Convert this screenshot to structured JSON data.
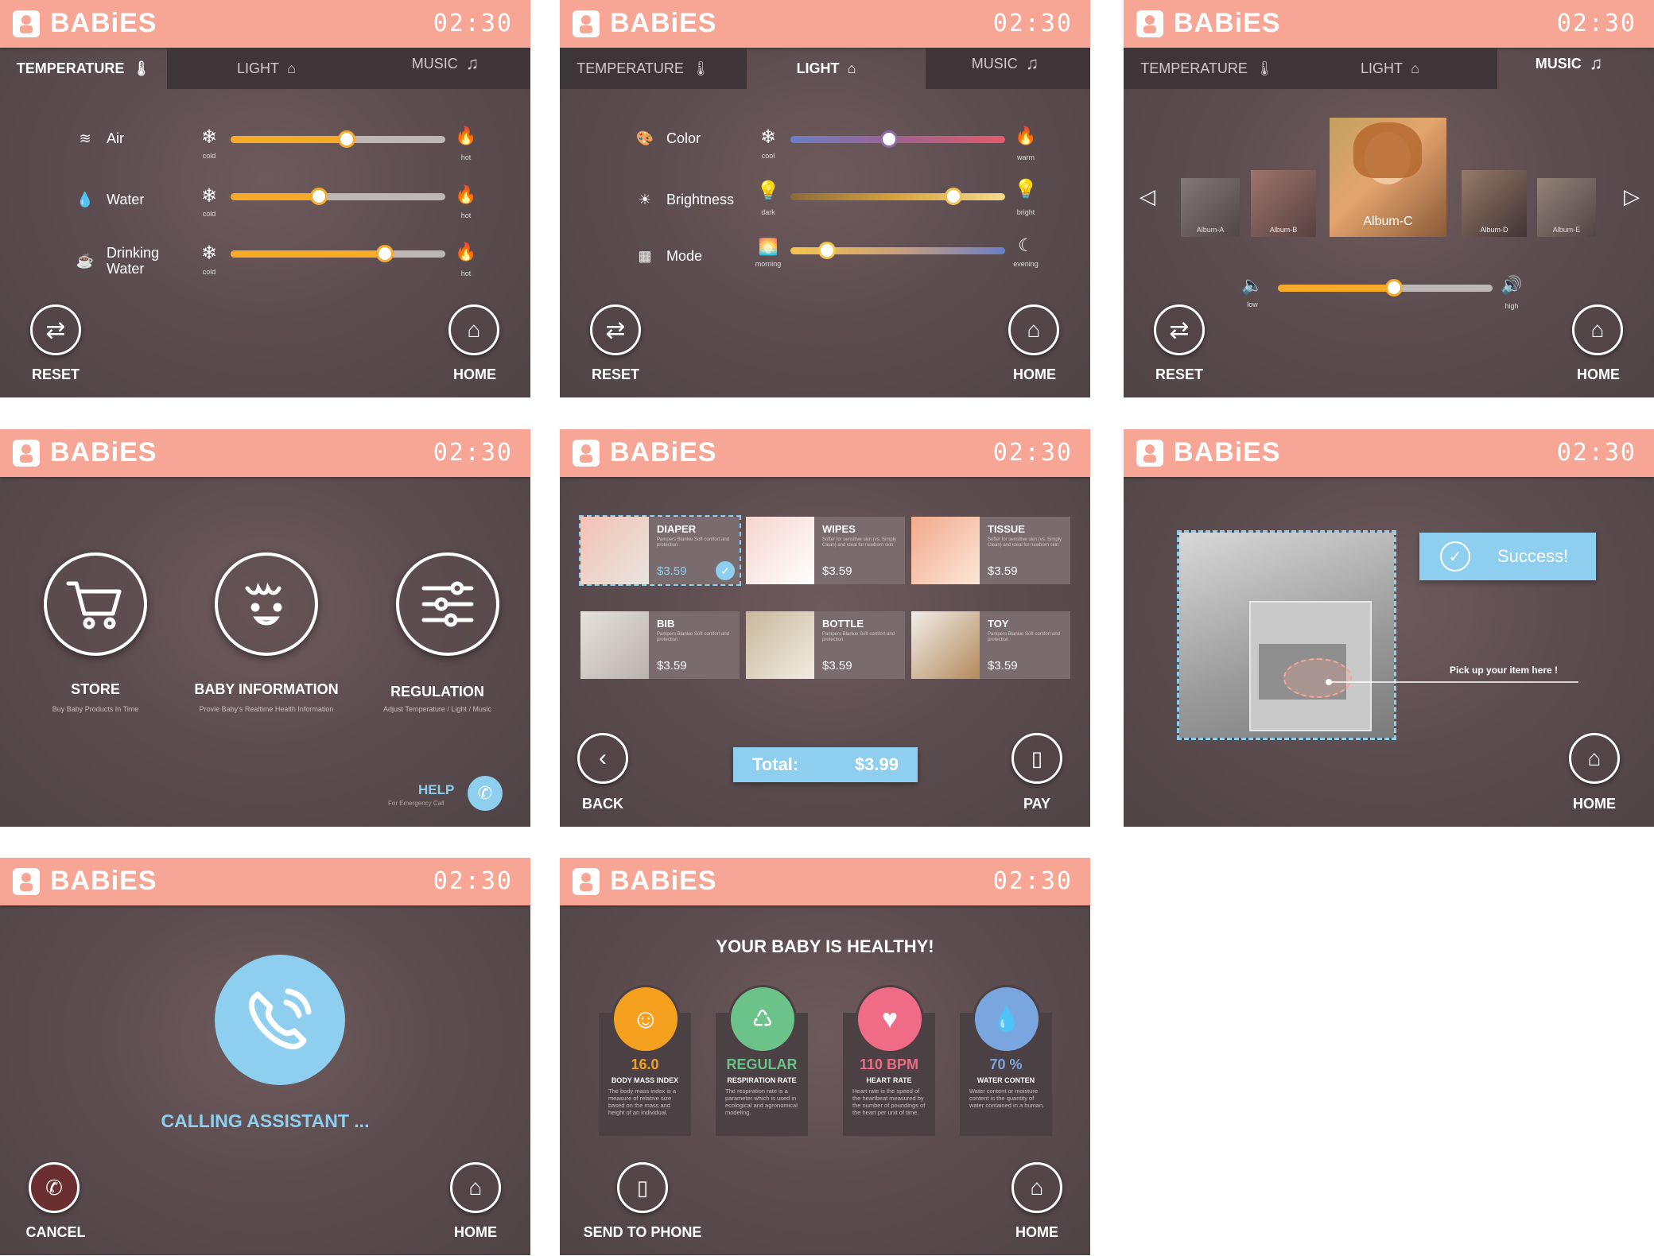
{
  "brand": "BABiES",
  "clock": "02:30",
  "colors": {
    "header": "#f7a696",
    "slider_fill": "#f5aa2a",
    "accent_blue": "#8ecff0",
    "bg": "#5b4c4f"
  },
  "tabs": {
    "temperature": "TEMPERATURE",
    "light": "LIGHT",
    "music": "MUSIC"
  },
  "buttons": {
    "reset": "RESET",
    "home": "HOME",
    "back": "BACK",
    "pay": "PAY",
    "cancel": "CANCEL",
    "send": "SEND TO PHONE"
  },
  "temperature": {
    "rows": [
      {
        "label": "Air",
        "left": "cold",
        "right": "hot",
        "level": 0.54
      },
      {
        "label": "Water",
        "left": "cold",
        "right": "hot",
        "level": 0.41
      },
      {
        "label": "Drinking\nWater",
        "label1": "Drinking",
        "label2": "Water",
        "left": "cold",
        "right": "hot",
        "level": 0.72
      }
    ]
  },
  "light": {
    "rows": [
      {
        "label": "Color",
        "left": "cool",
        "right": "warm",
        "level": 0.46
      },
      {
        "label": "Brightness",
        "left": "dark",
        "right": "bright",
        "level": 0.76
      },
      {
        "label": "Mode",
        "left": "morning",
        "right": "evening",
        "level": 0.17
      }
    ]
  },
  "music": {
    "albums": [
      "Album-A",
      "Album-B",
      "Album-C",
      "Album-D",
      "Album-E"
    ],
    "selected": "Album-C",
    "volume": {
      "left": "low",
      "right": "high",
      "level": 0.54
    }
  },
  "home_menu": {
    "items": [
      {
        "title": "STORE",
        "sub": "Buy Baby Products In Time",
        "icon": "cart-icon"
      },
      {
        "title": "BABY INFORMATION",
        "sub": "Provie Baby's Realtime Health Information",
        "icon": "baby-face-icon"
      },
      {
        "title": "REGULATION",
        "sub": "Adjust Temperature / Light / Music",
        "icon": "sliders-icon"
      }
    ],
    "help": "HELP",
    "help_sub": "For Emergency Call"
  },
  "store": {
    "products": [
      {
        "name": "DIAPER",
        "desc": "Pampers Blankie Soft comfort and protection",
        "price": "$3.59",
        "selected": true
      },
      {
        "name": "WIPES",
        "desc": "Softer for sensitive skin (vs. Simply Clean) and ideal for newborn skin",
        "price": "$3.59",
        "selected": false
      },
      {
        "name": "TISSUE",
        "desc": "Softer for sensitive skin (vs. Simply Clean) and ideal for newborn skin",
        "price": "$3.59",
        "selected": false
      },
      {
        "name": "BIB",
        "desc": "Pampers Blankie Soft comfort and protection",
        "price": "$3.59",
        "selected": false
      },
      {
        "name": "BOTTLE",
        "desc": "Pampers Blankie Soft comfort and protection",
        "price": "$3.59",
        "selected": false
      },
      {
        "name": "TOY",
        "desc": "Pampers Blankie Soft comfort and protection",
        "price": "$3.59",
        "selected": false
      }
    ],
    "total_label": "Total:",
    "total_value": "$3.99"
  },
  "pickup": {
    "success": "Success!",
    "caption": "Pick up your item here !"
  },
  "calling": {
    "text": "CALLING ASSISTANT ..."
  },
  "health": {
    "title": "YOUR BABY IS HEALTHY!",
    "stats": [
      {
        "value": "16.0",
        "label": "BODY MASS INDEX",
        "desc": "The body mass index is a measure of relative size based on the mass and height of an individual.",
        "color": "#f6a020",
        "icon": "baby-icon"
      },
      {
        "value": "REGULAR",
        "label": "RESPIRATION RATE",
        "desc": "The respiration rate is a parameter which is used in ecological and agronomical modeling.",
        "color": "#6cc38a",
        "icon": "lungs-icon"
      },
      {
        "value": "110 BPM",
        "label": "HEART RATE",
        "desc": "Heart rate is the speed of the heartbeat measured by the number of poundings of the heart per unit of time.",
        "color": "#f06b86",
        "icon": "heart-icon"
      },
      {
        "value": "70 %",
        "label": "WATER CONTEN",
        "desc": "Water content or moisture content is the quantity of water contained in a human.",
        "color": "#7aa6df",
        "icon": "water-drop-icon"
      }
    ]
  }
}
